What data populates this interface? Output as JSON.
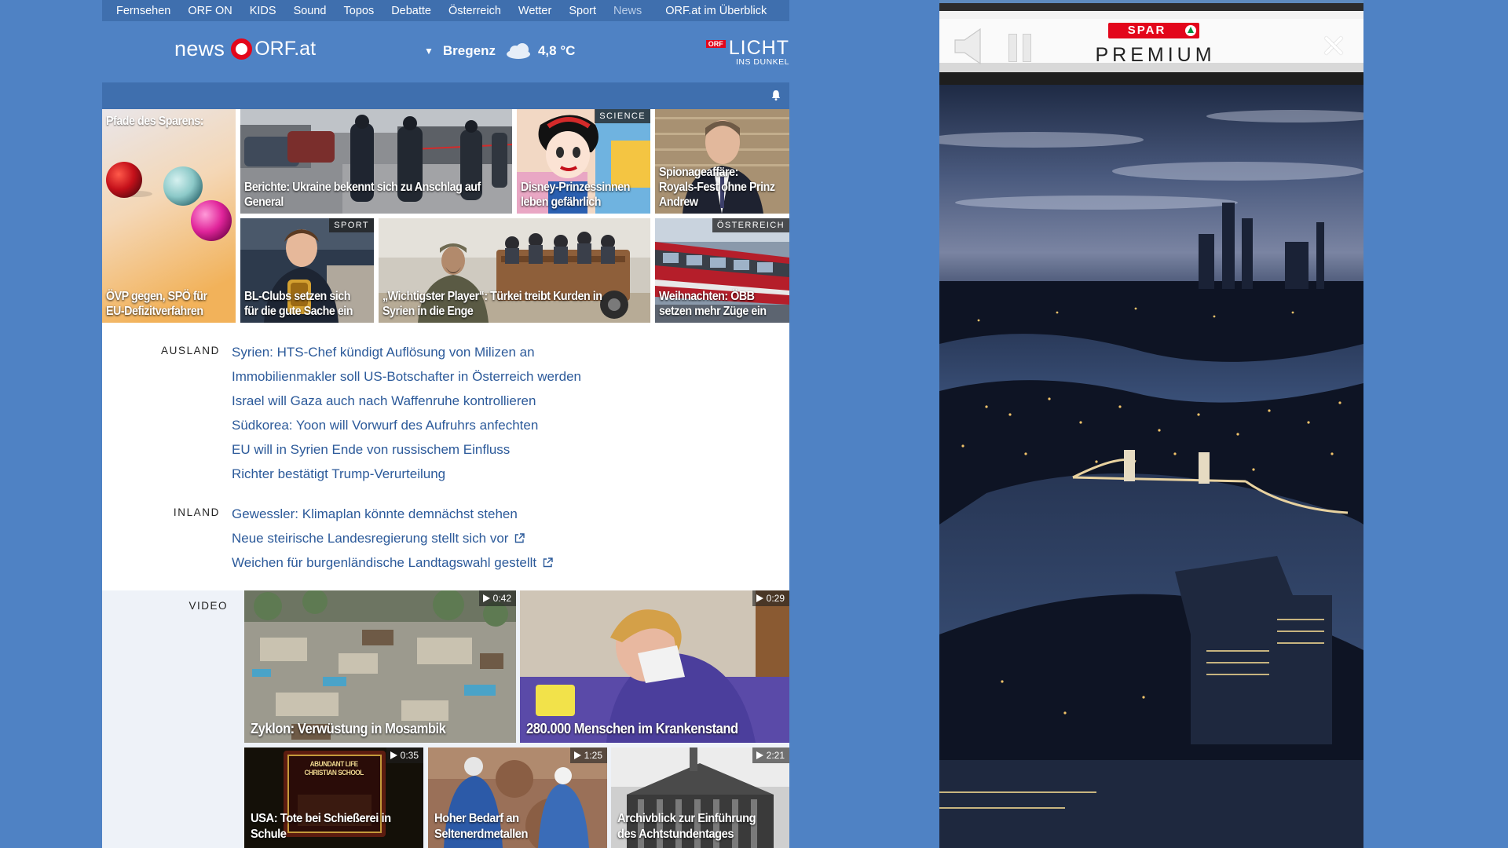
{
  "topnav": {
    "items": [
      "Fernsehen",
      "ORF ON",
      "KIDS",
      "Sound",
      "Topos",
      "Debatte",
      "Österreich",
      "Wetter",
      "Sport",
      "News"
    ],
    "overview": "ORF.at im Überblick"
  },
  "header": {
    "logo_news": "news",
    "logo_orf": "ORF.at",
    "weather_location": "Bregenz",
    "weather_temp": "4,8 °C",
    "licht_badge": "ORF",
    "licht_title": "LICHT",
    "licht_subtitle": "INS DUNKEL"
  },
  "teasers": [
    {
      "title": "Pfade des Sparens:",
      "caption": "ÖVP gegen, SPÖ für EU-Defizitverfahren"
    },
    {
      "caption": "Berichte: Ukraine bekennt sich zu Anschlag auf General"
    },
    {
      "tag": "SCIENCE",
      "caption": "Disney-Prinzessinnen leben gefährlich"
    },
    {
      "caption": "Spionageaffäre: Royals-Fest ohne Prinz Andrew"
    },
    {
      "tag": "SPORT",
      "caption": "BL-Clubs setzen sich für die gute Sache ein"
    },
    {
      "caption": "„Wichtigster Player“: Türkei treibt Kurden in Syrien in die Enge"
    },
    {
      "tag": "ÖSTERREICH",
      "caption": "Weihnachten: ÖBB setzen mehr Züge ein"
    }
  ],
  "sections": {
    "ausland": {
      "label": "AUSLAND",
      "items": [
        "Syrien: HTS-Chef kündigt Auflösung von Milizen an",
        "Immobilienmakler soll US-Botschafter in Österreich werden",
        "Israel will Gaza auch nach Waffenruhe kontrollieren",
        "Südkorea: Yoon will Vorwurf des Aufruhrs anfechten",
        "EU will in Syrien Ende von russischem Einfluss",
        "Richter bestätigt Trump-Verurteilung"
      ]
    },
    "inland": {
      "label": "INLAND",
      "items": [
        "Gewessler: Klimaplan könnte demnächst stehen",
        "Neue steirische Landesregierung stellt sich vor",
        "Weichen für burgenländische Landtagswahl gestellt"
      ]
    }
  },
  "video": {
    "label": "VIDEO",
    "items": [
      {
        "duration": "0:42",
        "caption": "Zyklon: Verwüstung in Mosambik"
      },
      {
        "duration": "0:29",
        "caption": "280.000 Menschen im Krankenstand"
      },
      {
        "duration": "0:35",
        "caption": "USA: Tote bei Schießerei in Schule",
        "sign": "ABUNDANT LIFE CHRISTIAN SCHOOL"
      },
      {
        "duration": "1:25",
        "caption": "Hoher Bedarf an Seltenerdmetallen"
      },
      {
        "duration": "2:21",
        "caption": "Archivblick zur Einführung des Achtstundentages"
      }
    ]
  },
  "ad": {
    "brand": "SPAR",
    "title": "PREMIUM"
  },
  "colors": {
    "page_blue": "#4f82c4",
    "nav_blue": "#3f6fae",
    "link_blue": "#2c5a9a",
    "orf_red": "#e3061b"
  }
}
